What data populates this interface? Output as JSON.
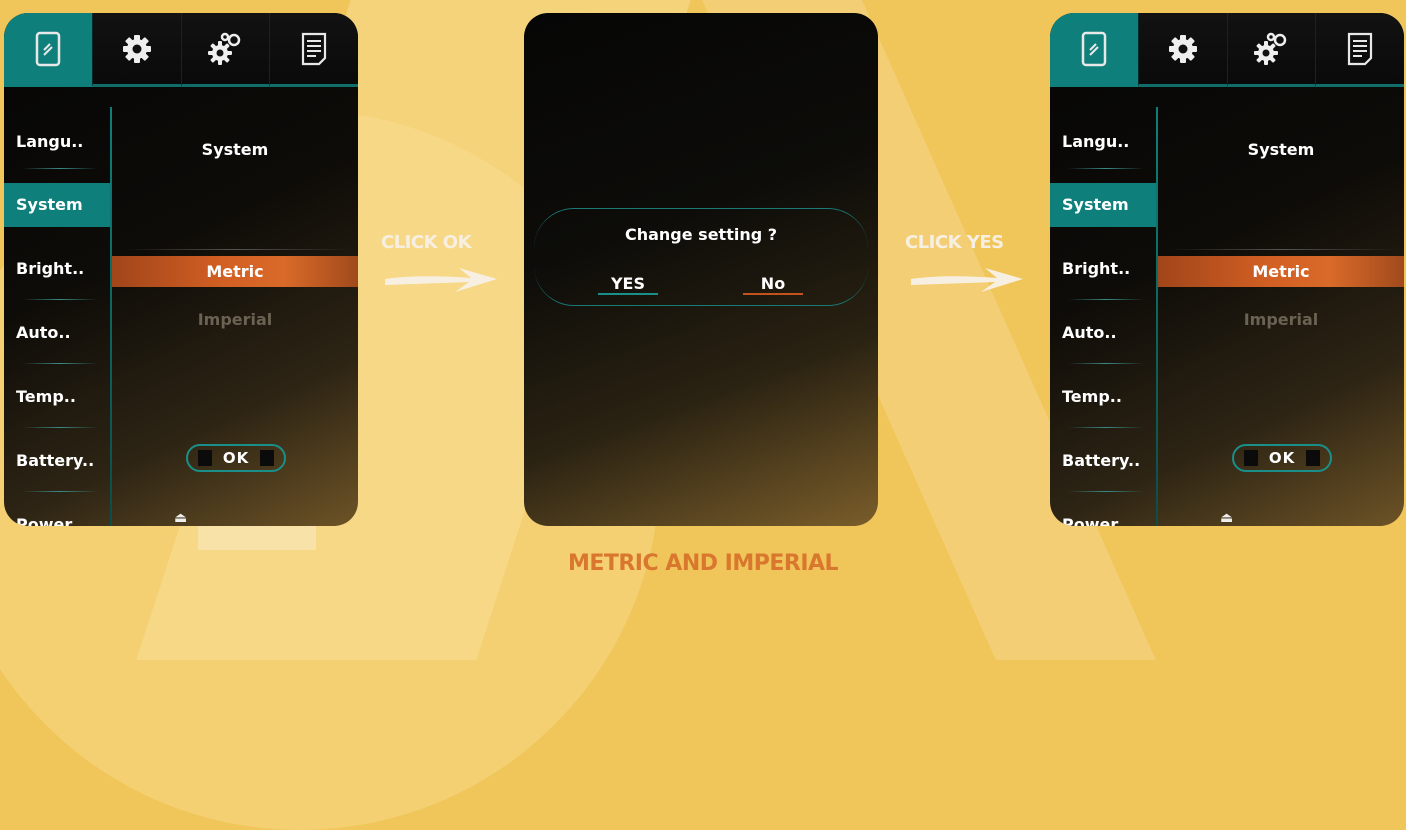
{
  "screens": [
    {
      "menu": [
        "Langu..",
        "System",
        "Bright..",
        "Auto..",
        "Temp..",
        "Battery..",
        "Power"
      ],
      "active_menu": "System",
      "content_title": "System",
      "selected_option": "Metric",
      "other_option": "Imperial",
      "ok_label": "OK"
    },
    {
      "dialog_title": "Change setting ?",
      "yes_label": "YES",
      "no_label": "No"
    },
    {
      "menu": [
        "Langu..",
        "System",
        "Bright..",
        "Auto..",
        "Temp..",
        "Battery..",
        "Power"
      ],
      "active_menu": "System",
      "content_title": "System",
      "selected_option": "Metric",
      "other_option": "Imperial",
      "ok_label": "OK"
    }
  ],
  "tabs": [
    "phone-icon",
    "gear-icon",
    "gears-icon",
    "document-icon"
  ],
  "step_labels": [
    "CLICK OK",
    "CLICK YES"
  ],
  "caption": "METRIC AND IMPERIAL",
  "colors": {
    "background": "#f0c65a",
    "accent_teal": "#0e7f7a",
    "accent_orange": "#d25f23",
    "caption": "#d9772e",
    "label": "#f7f0e2"
  }
}
